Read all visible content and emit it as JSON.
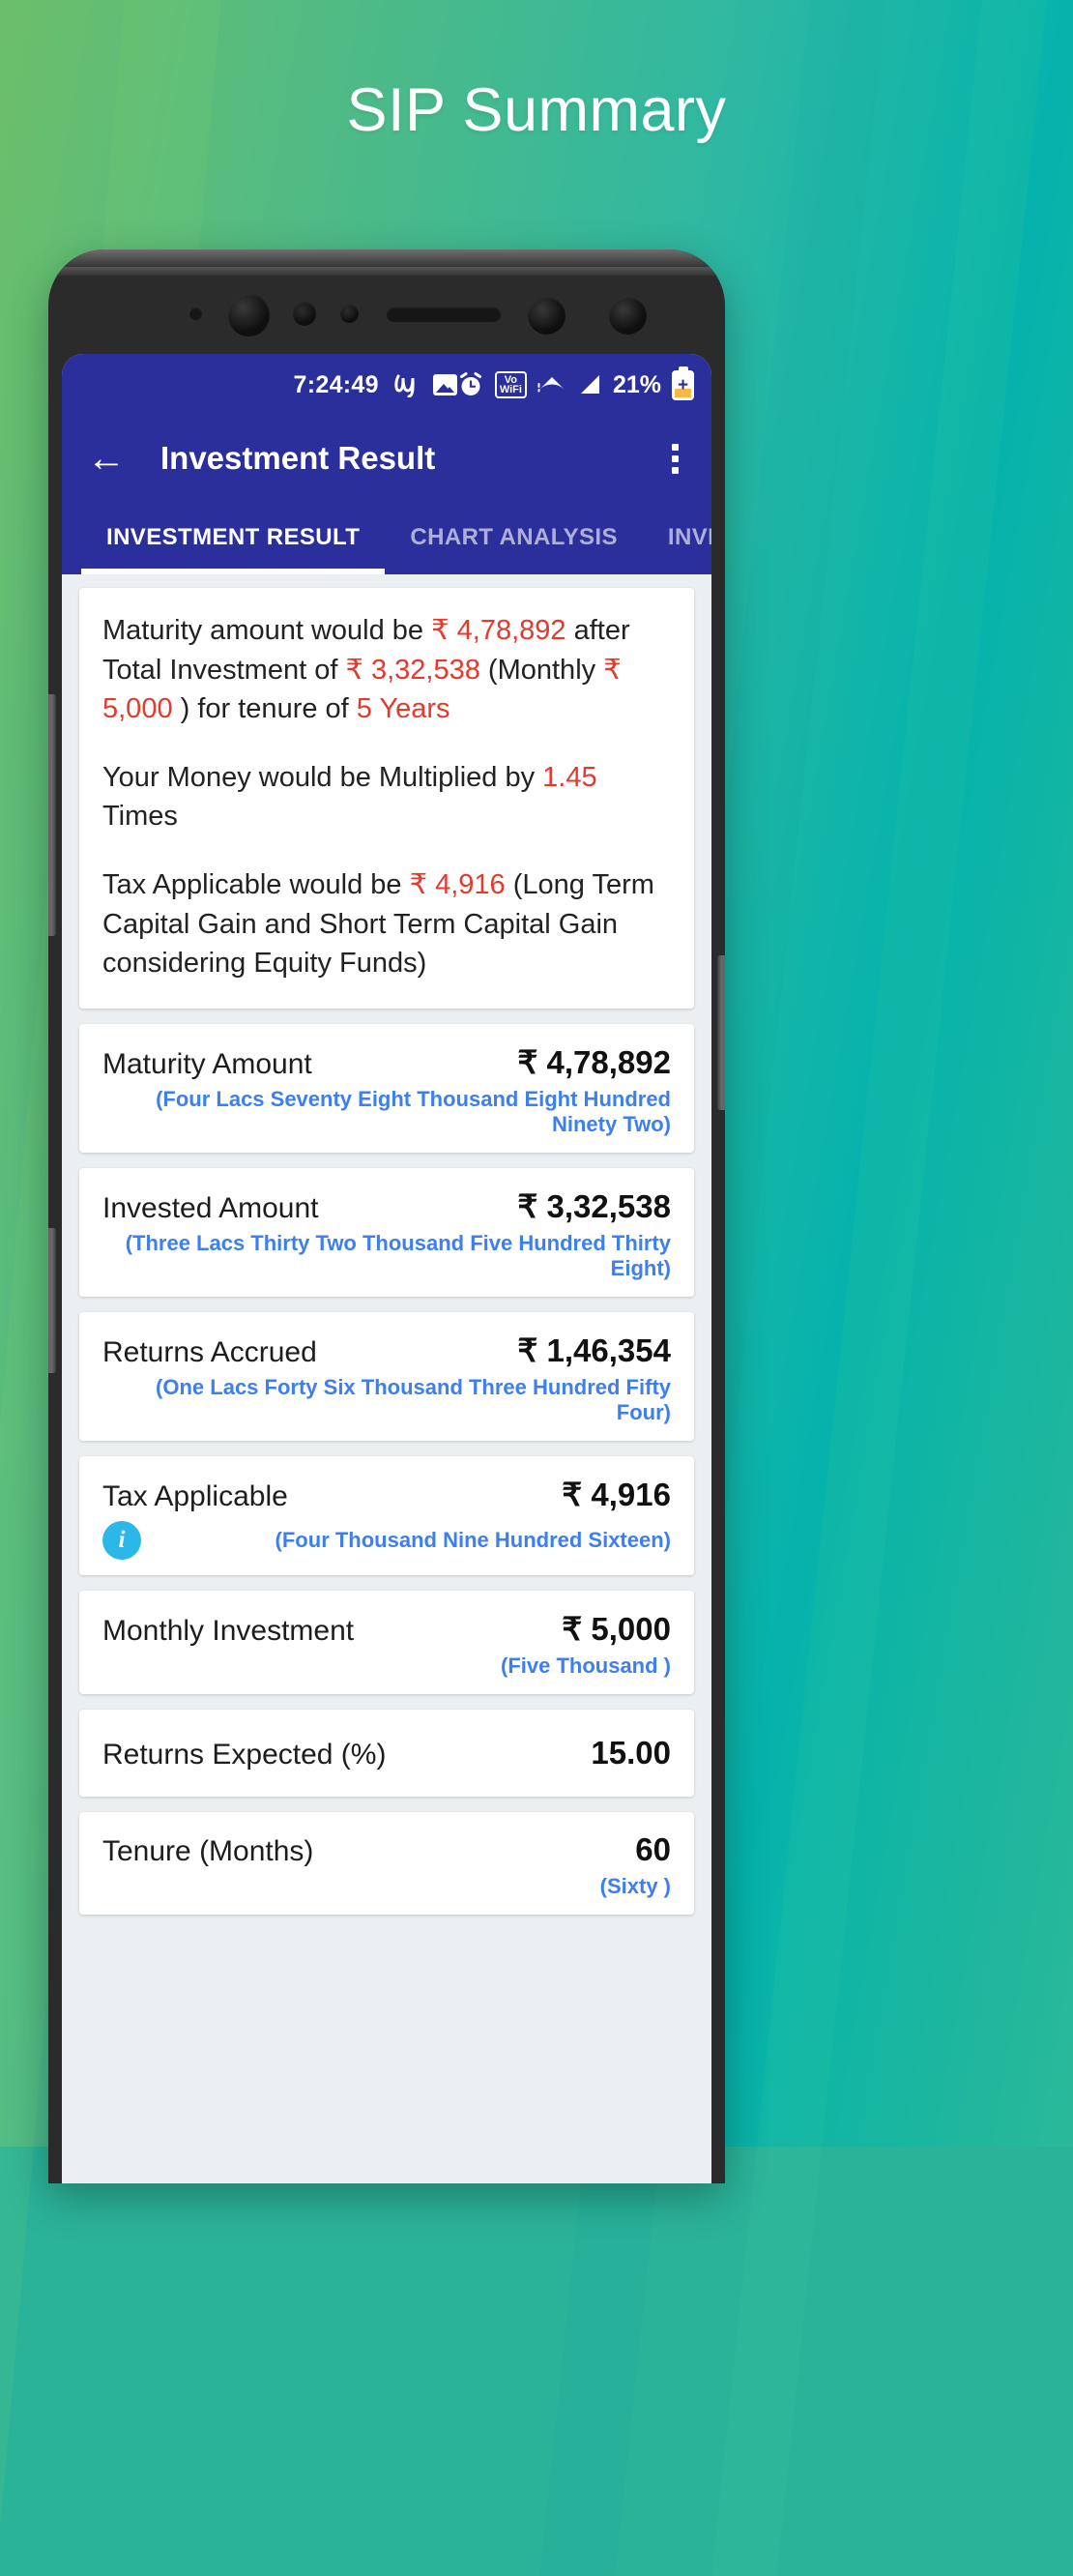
{
  "page": {
    "title": "SIP Summary",
    "gradient_from": "#6cbf6a",
    "gradient_to": "#05b3ac"
  },
  "statusbar": {
    "time": "7:24:49",
    "handwriting_icon": "ℰ",
    "image_icon": "image-icon",
    "alarm_icon": "⏰",
    "vowifi_line1": "Vo",
    "vowifi_line2": "WiFi",
    "battery_percent": "21%",
    "battery_plus": "+"
  },
  "appbar": {
    "back_label": "←",
    "title": "Investment Result",
    "accent": "#2a2f9c"
  },
  "tabs": [
    {
      "label": "INVESTMENT RESULT",
      "active": true
    },
    {
      "label": "CHART ANALYSIS",
      "active": false
    },
    {
      "label": "INVESTMEN",
      "active": false
    }
  ],
  "summary": {
    "line1_a": "Maturity amount would be ",
    "line1_h1": "₹ 4,78,892",
    "line1_b": " after Total Investment of ",
    "line1_h2": "₹ 3,32,538",
    "line1_c": " (Monthly ",
    "line1_h3": "₹ 5,000",
    "line1_d": " ) for tenure of ",
    "line1_h4": "5 Years",
    "line2_a": "Your Money would be Multiplied by ",
    "line2_h1": "1.45",
    "line2_b": " Times",
    "line3_a": "Tax Applicable would be ",
    "line3_h1": "₹ 4,916",
    "line3_b": " (Long Term Capital Gain and Short Term Capital Gain considering Equity Funds)",
    "highlight_color": "#e23b2e"
  },
  "rows": [
    {
      "label": "Maturity Amount",
      "value": "₹ 4,78,892",
      "words": "(Four Lacs Seventy Eight Thousand Eight Hundred Ninety Two)",
      "has_info": false
    },
    {
      "label": "Invested Amount",
      "value": "₹ 3,32,538",
      "words": "(Three Lacs Thirty Two Thousand Five Hundred Thirty Eight)",
      "has_info": false
    },
    {
      "label": "Returns Accrued",
      "value": "₹ 1,46,354",
      "words": "(One Lacs Forty Six Thousand Three Hundred Fifty Four)",
      "has_info": false
    },
    {
      "label": "Tax Applicable",
      "value": "₹ 4,916",
      "words": "(Four Thousand Nine Hundred Sixteen)",
      "has_info": true,
      "info_glyph": "i"
    },
    {
      "label": "Monthly Investment",
      "value": "₹ 5,000",
      "words": "(Five Thousand )",
      "has_info": false
    },
    {
      "label": "Returns Expected (%)",
      "value": "15.00",
      "words": "",
      "has_info": false
    },
    {
      "label": "Tenure (Months)",
      "value": "60",
      "words": "(Sixty )",
      "has_info": false
    }
  ],
  "words_color": "#3d7ff0"
}
